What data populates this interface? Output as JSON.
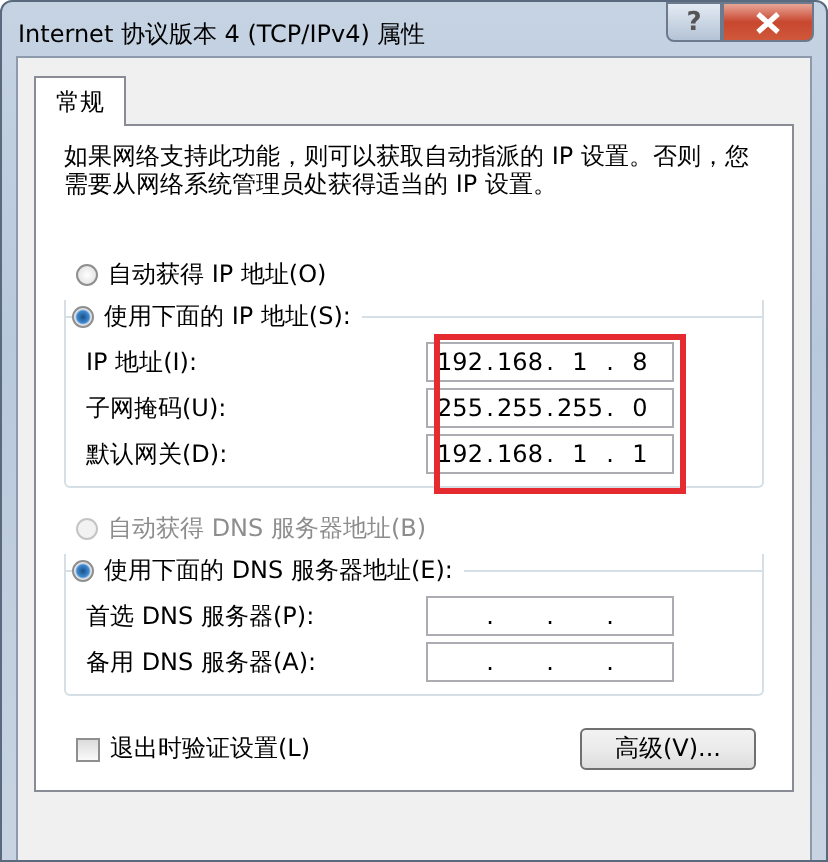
{
  "window": {
    "title": "Internet 协议版本 4 (TCP/IPv4) 属性",
    "help_button": "?"
  },
  "tabs": [
    {
      "label": "常规",
      "selected": true
    }
  ],
  "description": "如果网络支持此功能，则可以获取自动指派的 IP 设置。否则，您需要从网络系统管理员处获得适当的 IP 设置。",
  "octet_separator": ".",
  "ip_mode": [
    {
      "label": "自动获得 IP 地址(O)",
      "selected": false,
      "disabled": false
    },
    {
      "label": "使用下面的 IP 地址(S):",
      "selected": true,
      "disabled": false
    }
  ],
  "ip_settings": {
    "highlighted": true,
    "fields": [
      {
        "label": "IP 地址(I):",
        "octets": [
          "192",
          "168",
          "1",
          "8"
        ]
      },
      {
        "label": "子网掩码(U):",
        "octets": [
          "255",
          "255",
          "255",
          "0"
        ]
      },
      {
        "label": "默认网关(D):",
        "octets": [
          "192",
          "168",
          "1",
          "1"
        ]
      }
    ]
  },
  "dns_mode": [
    {
      "label": "自动获得 DNS 服务器地址(B)",
      "selected": false,
      "disabled": true
    },
    {
      "label": "使用下面的 DNS 服务器地址(E):",
      "selected": true,
      "disabled": false
    }
  ],
  "dns_settings": {
    "fields": [
      {
        "label": "首选 DNS 服务器(P):"
      },
      {
        "label": "备用 DNS 服务器(A):"
      }
    ]
  },
  "validate_on_exit": {
    "label": "退出时验证设置(L)",
    "checked": false
  },
  "advanced_button": "高级(V)..."
}
